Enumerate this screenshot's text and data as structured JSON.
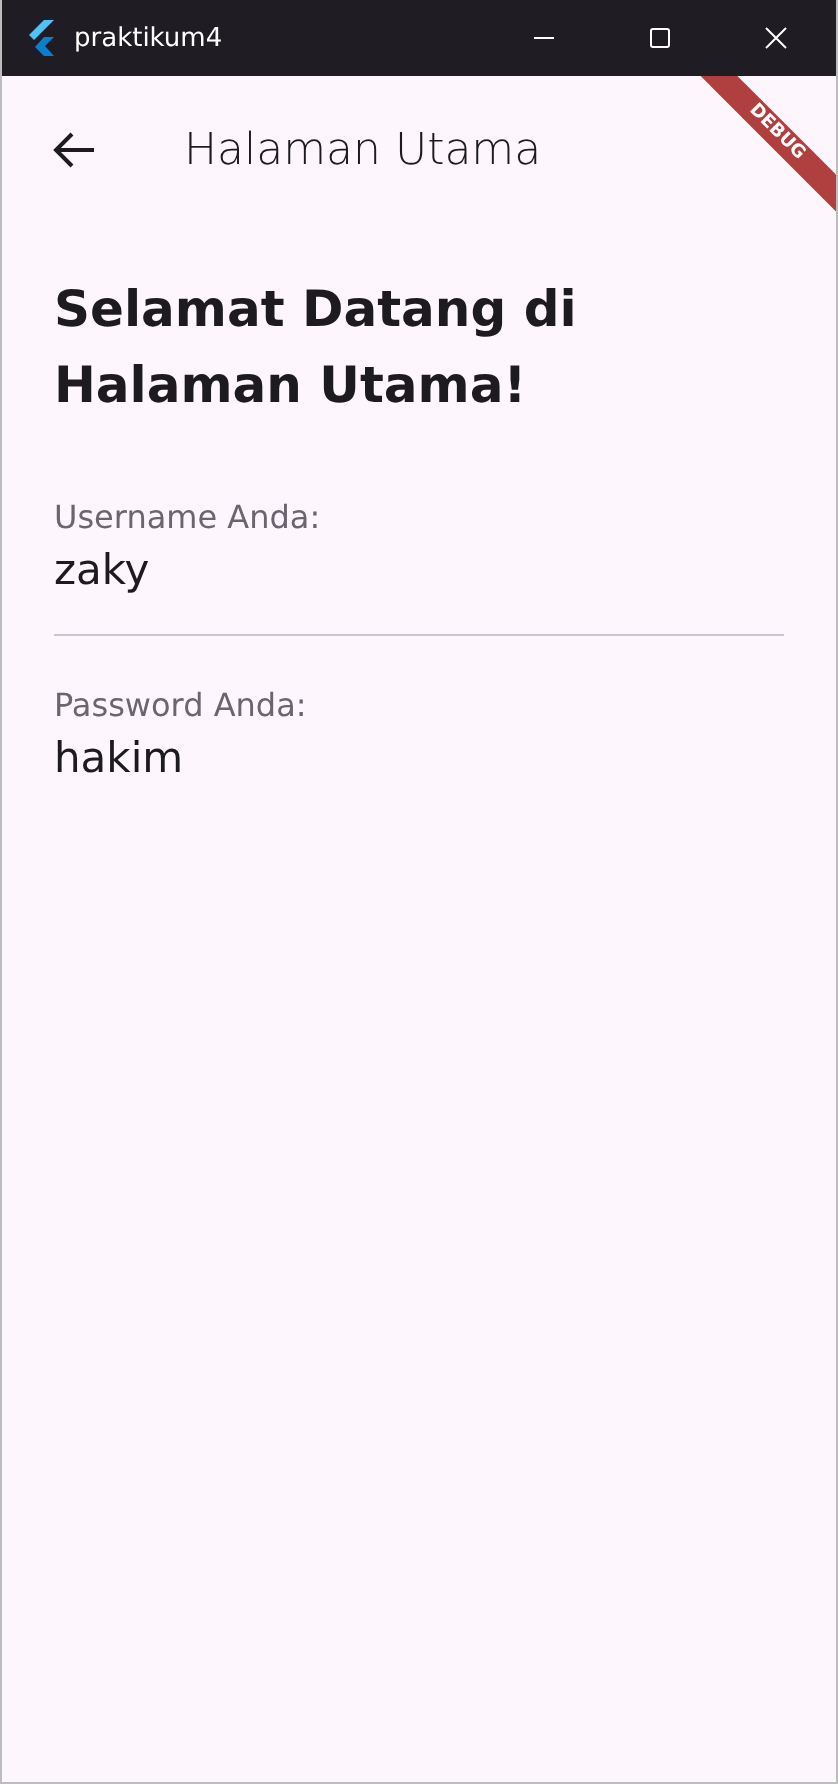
{
  "window": {
    "title": "praktikum4"
  },
  "app_bar": {
    "title": "Halaman Utama"
  },
  "debug_banner": "DEBUG",
  "heading": "Selamat Datang di Halaman Utama!",
  "fields": [
    {
      "label": "Username Anda:",
      "value": "zaky"
    },
    {
      "label": "Password Anda:",
      "value": "hakim"
    }
  ]
}
